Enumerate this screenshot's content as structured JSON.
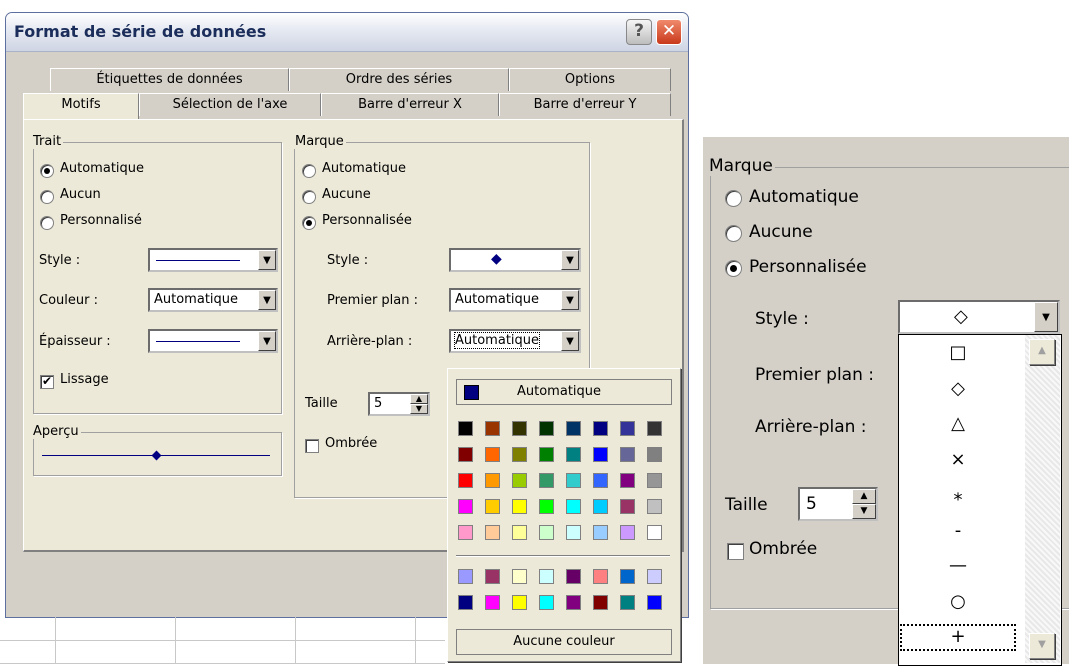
{
  "dialog": {
    "title": "Format de série de données",
    "help_label": "?",
    "close_label": "✕"
  },
  "tabs_back": [
    "Étiquettes de données",
    "Ordre des séries",
    "Options"
  ],
  "tabs_front": [
    "Motifs",
    "Sélection de l'axe",
    "Barre d'erreur X",
    "Barre d'erreur Y"
  ],
  "active_tab": "Motifs",
  "trait": {
    "legend": "Trait",
    "options": [
      "Automatique",
      "Aucun",
      "Personnalisé"
    ],
    "selected": "Automatique",
    "style_label": "Style :",
    "couleur_label": "Couleur :",
    "couleur_value": "Automatique",
    "epaisseur_label": "Épaisseur :",
    "lissage_label": "Lissage",
    "lissage_checked": true
  },
  "apercu": {
    "legend": "Aperçu"
  },
  "marque": {
    "legend": "Marque",
    "options": [
      "Automatique",
      "Aucune",
      "Personnalisée"
    ],
    "selected": "Personnalisée",
    "style_label": "Style :",
    "premier_plan_label": "Premier plan :",
    "premier_plan_value": "Automatique",
    "arriere_plan_label": "Arrière-plan :",
    "arriere_plan_value": "Automatique",
    "taille_label": "Taille",
    "taille_value": "5",
    "ombree_label": "Ombrée",
    "style_symbol": "◆"
  },
  "color_popup": {
    "auto_label": "Automatique",
    "none_label": "Aucune couleur",
    "rows": [
      [
        "#000000",
        "#993300",
        "#333300",
        "#003300",
        "#003366",
        "#000080",
        "#333399",
        "#333333"
      ],
      [
        "#800000",
        "#FF6600",
        "#808000",
        "#008000",
        "#008080",
        "#0000FF",
        "#666699",
        "#808080"
      ],
      [
        "#FF0000",
        "#FF9900",
        "#99CC00",
        "#339966",
        "#33CCCC",
        "#3366FF",
        "#800080",
        "#969696"
      ],
      [
        "#FF00FF",
        "#FFCC00",
        "#FFFF00",
        "#00FF00",
        "#00FFFF",
        "#00CCFF",
        "#993366",
        "#C0C0C0"
      ],
      [
        "#FF99CC",
        "#FFCC99",
        "#FFFF99",
        "#CCFFCC",
        "#CCFFFF",
        "#99CCFF",
        "#CC99FF",
        "#FFFFFF"
      ]
    ],
    "rows2": [
      [
        "#9999FF",
        "#993366",
        "#FFFFCC",
        "#CCFFFF",
        "#660066",
        "#FF8080",
        "#0066CC",
        "#CCCCFF"
      ],
      [
        "#000080",
        "#FF00FF",
        "#FFFF00",
        "#00FFFF",
        "#800080",
        "#800000",
        "#008080",
        "#0000FF"
      ]
    ]
  },
  "zoom": {
    "legend": "Marque",
    "options": [
      "Automatique",
      "Aucune",
      "Personnalisée"
    ],
    "selected": "Personnalisée",
    "style_label": "Style :",
    "style_value": "◇",
    "premier_plan_label": "Premier plan :",
    "arriere_plan_label": "Arrière-plan :",
    "taille_label": "Taille",
    "taille_value": "5",
    "ombree_label": "Ombrée",
    "marker_list": [
      "□",
      "◇",
      "△",
      "×",
      "⁎",
      "-",
      "—",
      "○",
      "+"
    ],
    "selected_marker": "+"
  },
  "colors": {
    "line": "#000080",
    "title": "#1b2d5a"
  }
}
